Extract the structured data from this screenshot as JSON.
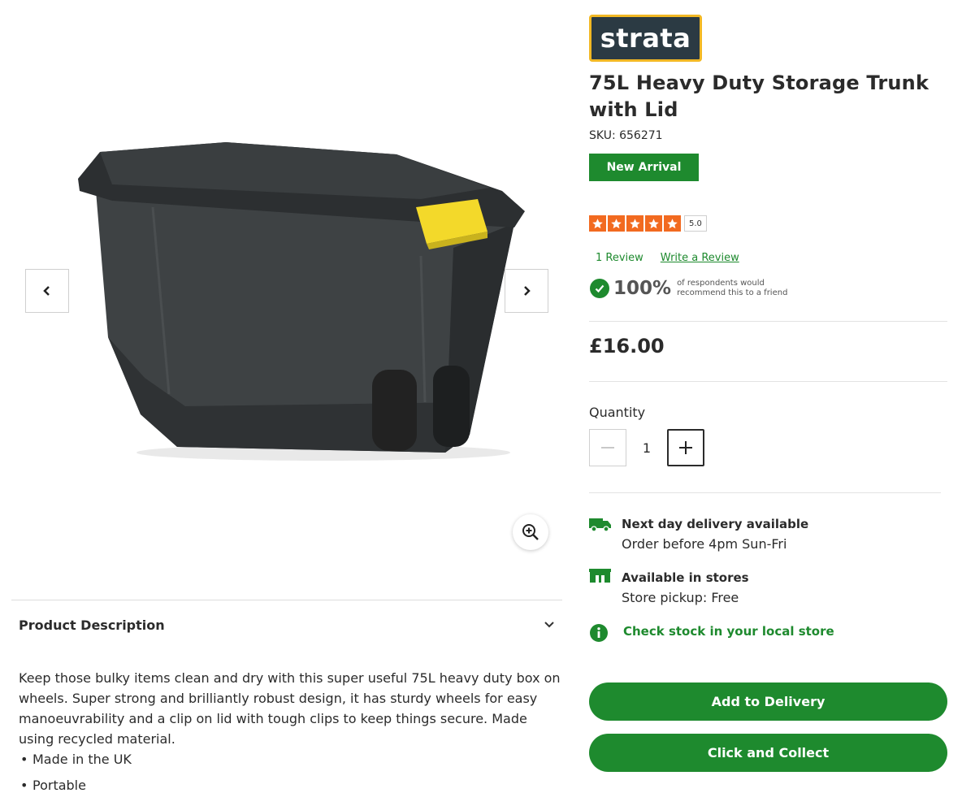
{
  "brand": {
    "logo_text": "strata",
    "logo_bg": "#2b3a43",
    "logo_border": "#f2b824"
  },
  "product": {
    "title": "75L Heavy Duty Storage Trunk with Lid",
    "sku": "SKU: 656271",
    "badge": "New Arrival",
    "price": "£16.00"
  },
  "rating": {
    "stars": 5,
    "score": "5.0",
    "review_count": "1 Review",
    "write_review": "Write a Review",
    "recommend_percent": "100%",
    "recommend_line1": "of respondents would",
    "recommend_line2": "recommend this to a friend"
  },
  "quantity": {
    "label": "Quantity",
    "value": "1"
  },
  "fulfilment": {
    "delivery_title": "Next day delivery available",
    "delivery_sub": "Order before 4pm Sun-Fri",
    "stores_title": "Available in stores",
    "stores_sub": "Store pickup: Free",
    "check_stock": "Check stock in your local store"
  },
  "actions": {
    "add_to_delivery": "Add to Delivery",
    "click_and_collect": "Click and Collect"
  },
  "description": {
    "heading": "Product Description",
    "text": "Keep those bulky items clean and dry with this super useful 75L heavy duty box on wheels. Super strong and brilliantly robust design, it has sturdy wheels for easy manoeuvrability and a clip on lid with tough clips to keep things secure. Made using recycled material.",
    "bullets": [
      "Made in the UK",
      "Portable"
    ]
  },
  "icons": {
    "prev": "chevron-left-icon",
    "next": "chevron-right-icon",
    "zoom": "zoom-in-icon",
    "expand": "chevron-down-icon",
    "delivery": "delivery-truck-icon",
    "store": "store-icon",
    "info": "info-icon",
    "recommend": "check-circle-icon"
  },
  "colors": {
    "accent_green": "#1e8a2e",
    "star_orange": "#f26a20",
    "text": "#2b2b2b",
    "clip_yellow": "#f3d92a"
  }
}
